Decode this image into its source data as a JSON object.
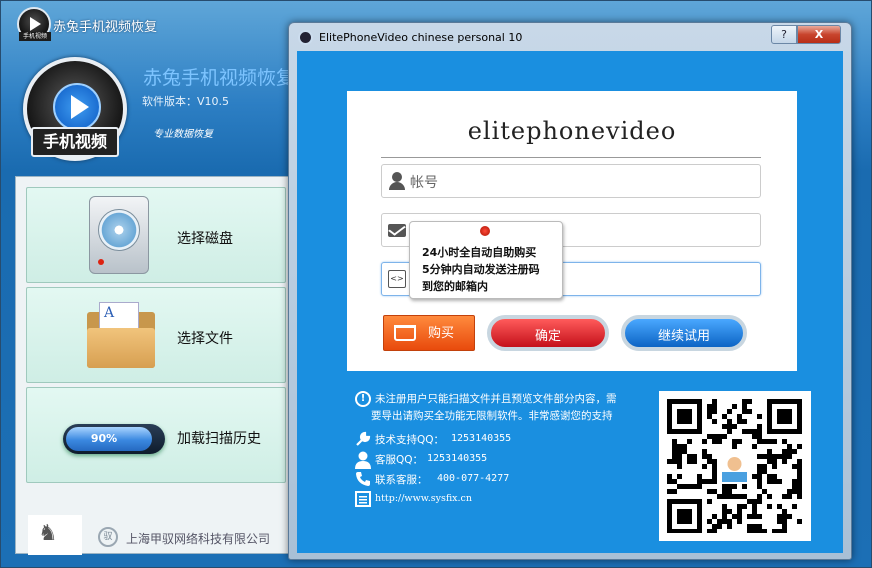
{
  "main_window": {
    "title": "赤兔手机视频恢复",
    "icon_tag": "手机视频",
    "app_name": "赤兔手机视频恢复",
    "version": "软件版本：V10.5",
    "slogan": "专业数据恢复",
    "logo_label": "手机视频",
    "menu": [
      {
        "label": "选择磁盘",
        "icon": "disk-icon"
      },
      {
        "label": "选择文件",
        "icon": "folder-icon"
      },
      {
        "label": "加载扫描历史",
        "icon": "progress-icon",
        "progress_text": "90%",
        "progress_value": 0.9
      }
    ],
    "company": {
      "name": "上海甲驭网络科技有限公司",
      "circle_mark": "甲驭"
    }
  },
  "dialog": {
    "title": "ElitePhoneVideo chinese personal 10",
    "window_buttons": {
      "help": "?",
      "close": "X"
    },
    "heading": "elitephonevideo",
    "account_placeholder": "帐号",
    "tooltip_lines": [
      "24小时全自动自助购买",
      "5分钟内自动发送注册码",
      "到您的邮箱内"
    ],
    "code_icon_text": "<>",
    "buttons": {
      "buy": "购买",
      "confirm": "确定",
      "trial": "继续试用"
    },
    "notice_lines": [
      "未注册用户只能扫描文件并且预览文件部分内容，需",
      "要导出请购买全功能无限制软件。非常感谢您的支持"
    ],
    "notice_icon_text": "!",
    "contacts": [
      {
        "label": "技术支持QQ：",
        "value": "1253140355",
        "icon": "wrench-icon"
      },
      {
        "label": "客服QQ：",
        "value": "1253140355",
        "icon": "person-icon"
      },
      {
        "label": "联系客服：",
        "value": "400-077-4277",
        "icon": "phone-icon"
      }
    ],
    "url": "http://www.sysfix.cn",
    "colors": {
      "dialog_body": "#1a8fe0",
      "buy": "#e84a0c",
      "confirm": "#c4101a",
      "trial": "#0c64c4"
    }
  }
}
